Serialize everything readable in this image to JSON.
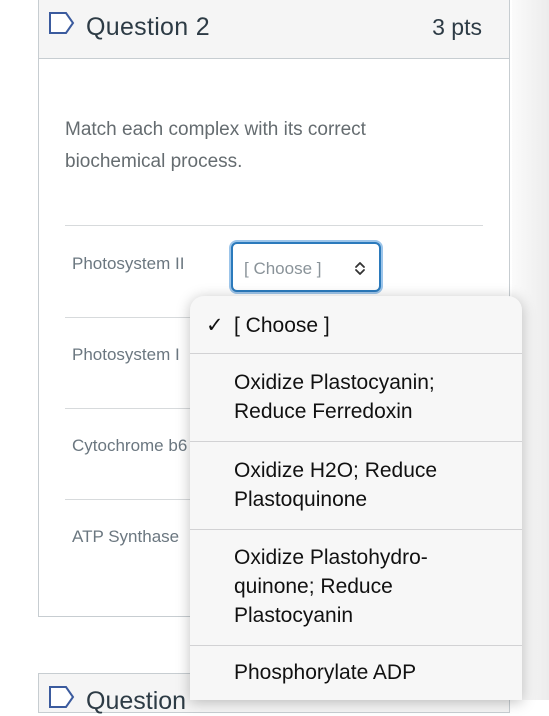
{
  "question": {
    "title": "Question 2",
    "points": "3 pts",
    "text": "Match each complex with its correct biochemical process."
  },
  "matches": [
    {
      "label": "Photosystem II"
    },
    {
      "label": "Photosystem I"
    },
    {
      "label": "Cytochrome b6"
    },
    {
      "label": "ATP Synthase"
    }
  ],
  "select": {
    "value": "[ Choose ]"
  },
  "dropdown": {
    "selected_mark": "✓",
    "options": [
      "[ Choose ]",
      "Oxidize Plastocyanin; Reduce Ferredoxin",
      "Oxidize H2O; Reduce Plastoquinone",
      "Oxidize Plastohydro-quinone; Reduce Plastocyanin",
      "Phosphorylate ADP"
    ]
  },
  "next_question": {
    "title": "Question"
  },
  "icons": {
    "flag": "flag-outline-icon",
    "select_chevrons": "up-down-chevron-icon"
  },
  "colors": {
    "accent": "#2b7abc",
    "text": "#2d3b45"
  }
}
